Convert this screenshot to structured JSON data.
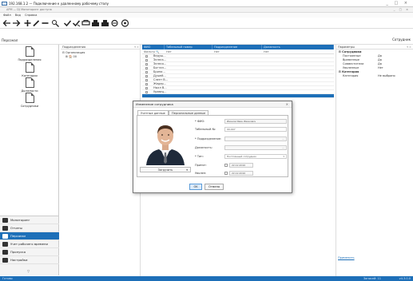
{
  "rdp": {
    "title": "192.168.1.2 — Подключение к удаленному рабочему столу",
    "controls": "_ □ ×"
  },
  "app": {
    "title": "АРМ — DJ Мониторинг доступа",
    "controls": "_ □ ×"
  },
  "menu": [
    "Файл",
    "Вид",
    "Справка"
  ],
  "toolbar": [
    "back-icon",
    "forward-icon",
    "add-icon",
    "edit-icon",
    "delete-icon",
    "find-icon",
    "check-icon",
    "uncheck-icon",
    "copy-icon",
    "print1-icon",
    "print2-icon",
    "print3-icon",
    "help-icon"
  ],
  "strip": {
    "left_label": "Персонал",
    "right_label": "Сотрудник"
  },
  "left_panel": {
    "items": [
      {
        "label": "Подразделения"
      },
      {
        "label": "Категории"
      },
      {
        "label": "Должности"
      },
      {
        "label": "Сотрудники"
      }
    ]
  },
  "nav": {
    "items": [
      {
        "label": "Мониторинг",
        "icon": "monitoring-icon"
      },
      {
        "label": "Отчеты",
        "icon": "reports-icon"
      },
      {
        "label": "Персонал",
        "icon": "personnel-icon",
        "active": true
      },
      {
        "label": "Учет рабочего времени",
        "icon": "time-icon"
      },
      {
        "label": "Пропуска",
        "icon": "passes-icon"
      },
      {
        "label": "Настройки",
        "icon": "settings-icon"
      }
    ],
    "bottom": "▽"
  },
  "departments": {
    "header": "Подразделения",
    "controls": "▾ ×",
    "tree": [
      "⊟ Организация",
      "⊞ 🏠 00"
    ]
  },
  "grid": {
    "headers": [
      "ФИО",
      "Табельный номер",
      "Подразделение",
      "Должность"
    ],
    "filters": [
      "Фильтр 🔍",
      "Нет",
      "Нет",
      "Нет"
    ],
    "rows": [
      "Ведуш...",
      "Зелеск...",
      "Зелесо...",
      "Богтан...",
      "Брини...",
      "Душей...",
      "Слепт В...",
      "Жедер...",
      "Ныхл В...",
      "Уравец..."
    ],
    "selected_row": 10
  },
  "params": {
    "header": "Параметры",
    "controls": "▾ ×",
    "rows": [
      {
        "type": "group",
        "k": "⊟ Сотрудники",
        "v": ""
      },
      {
        "type": "row",
        "k": "Постоянные",
        "v": "Да"
      },
      {
        "type": "row",
        "k": "Временные",
        "v": "Да"
      },
      {
        "type": "row",
        "k": "Совместители",
        "v": "Да"
      },
      {
        "type": "row",
        "k": "Уволенные",
        "v": "Нет"
      },
      {
        "type": "group",
        "k": "⊟ Категория",
        "v": ""
      },
      {
        "type": "row",
        "k": "Категория",
        "v": "Не выбрано"
      }
    ],
    "link": "Применить"
  },
  "status": {
    "left": "Готово",
    "right1": "Записей: 11",
    "right2": "v4.3.0.0"
  },
  "dialog": {
    "title": "Изменение сотрудника",
    "close": "×",
    "tabs": [
      "Учетные данные",
      "Персональные данные"
    ],
    "upload": "Загрузить",
    "upload_dd": "▾",
    "fields": {
      "fio_label": "* ФИО:",
      "fio_value": "Иванов Иван Иванович",
      "tab_label": "Табельный №:",
      "tab_value": "00-007",
      "dept_label": "* Подразделение:",
      "dept_value": "",
      "pos_label": "Должность:",
      "pos_value": "",
      "type_label": "* Тип:",
      "type_value": "Постоянный сотрудник",
      "hired_label": "Принят:",
      "hired_value": "22.12.2010",
      "fired_label": "Уволен:",
      "fired_value": "22.12.2010"
    },
    "ok": "OK",
    "cancel": "Отмена"
  }
}
